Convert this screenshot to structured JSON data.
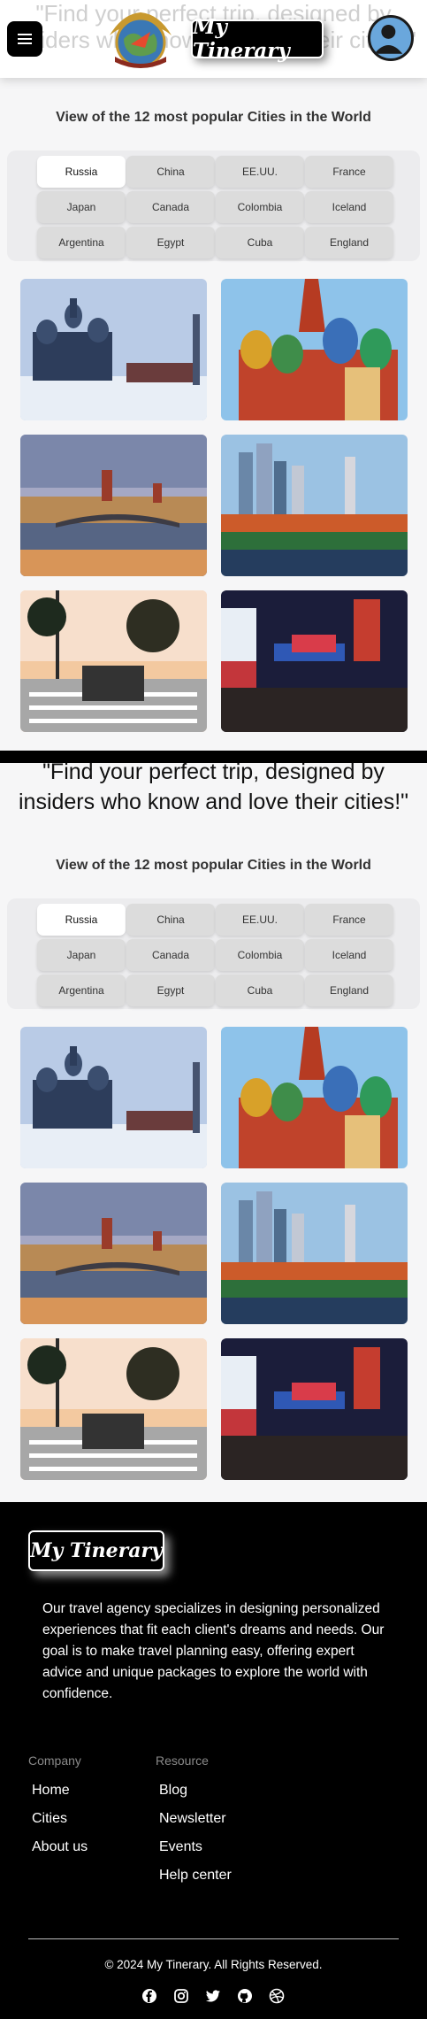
{
  "header": {
    "ghost_line_1": "\"Find your perfect trip, designed by",
    "ghost_line_2": "insiders who know and love their cities!\"",
    "logo": "My Tinerary",
    "menu_icon": "hamburger-icon",
    "avatar_icon": "user-avatar-icon"
  },
  "popular": {
    "title": "View of the 12 most popular Cities in the World",
    "tabs": [
      "Russia",
      "China",
      "EE.UU.",
      "France",
      "Japan",
      "Canada",
      "Colombia",
      "Iceland",
      "Argentina",
      "Egypt",
      "Cuba",
      "England"
    ],
    "active_tab": "Russia"
  },
  "hero_quote": {
    "line_1": "\"Find your perfect trip, designed by",
    "line_2": "insiders who know and love their cities!\""
  },
  "footer": {
    "logo": "My Tinerary",
    "description": "Our travel agency specializes in designing personalized experiences that fit each client's dreams and needs. Our goal is to make travel planning easy, offering expert advice and unique packages to explore the world with confidence.",
    "company": {
      "title": "Company",
      "links": [
        "Home",
        "Cities",
        "About us"
      ]
    },
    "resource": {
      "title": "Resource",
      "links": [
        "Blog",
        "Newsletter",
        "Events",
        "Help center"
      ]
    },
    "copyright": "© 2024 My Tinerary. All Rights Reserved.",
    "social_icons": [
      "facebook-icon",
      "instagram-icon",
      "twitter-icon",
      "github-icon",
      "dribbble-icon"
    ]
  },
  "colors": {
    "accent": "#000000",
    "avatar": "#6aa7dc",
    "tab_bg": "#dcdcdc",
    "panel_bg": "#ececee"
  }
}
